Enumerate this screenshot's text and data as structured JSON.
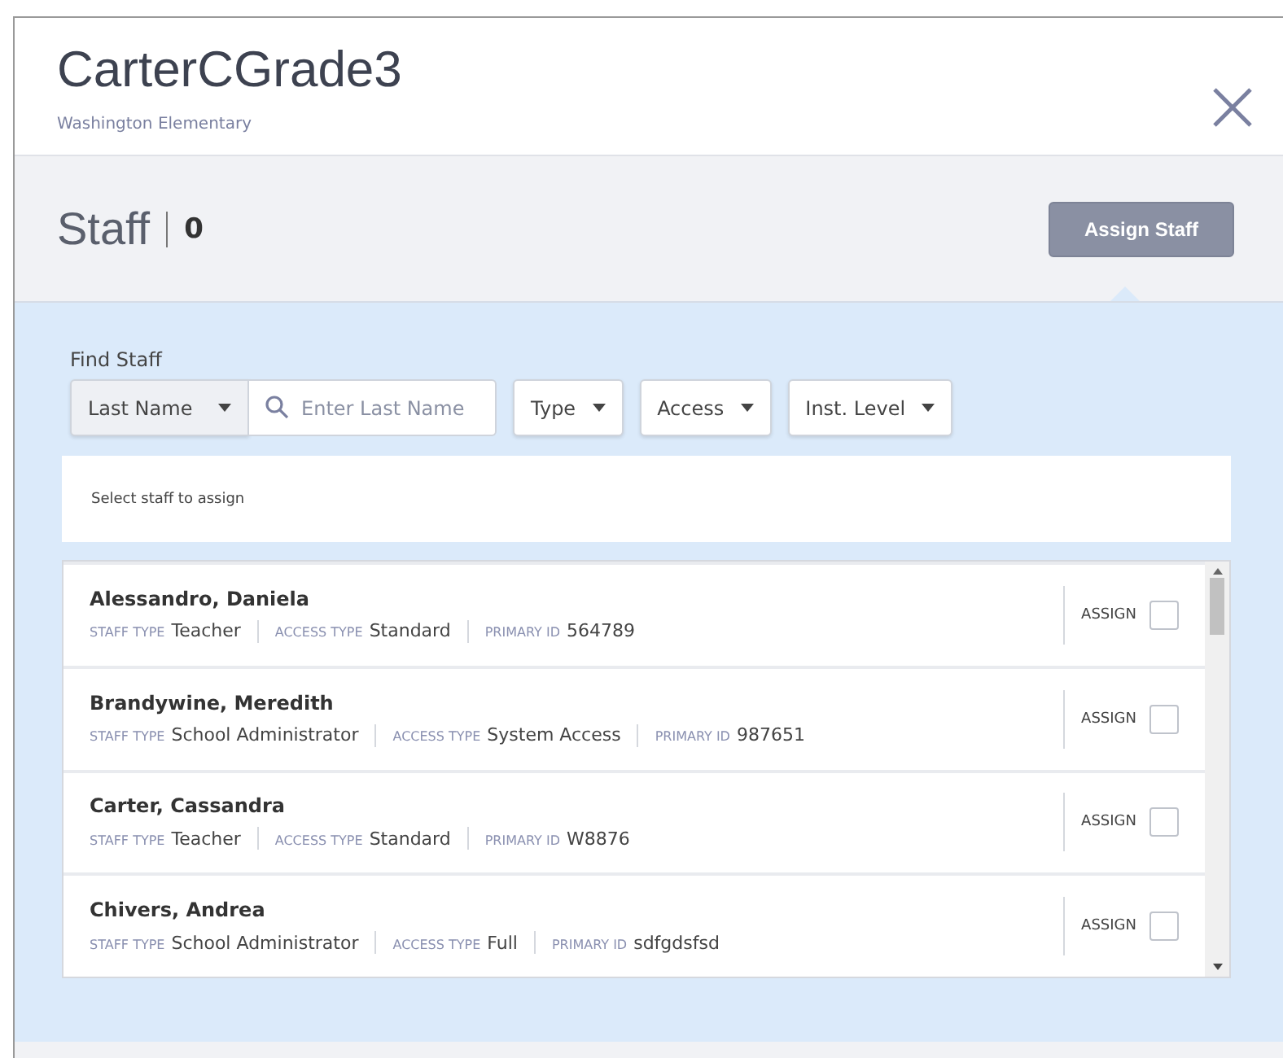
{
  "header": {
    "title": "CarterCGrade3",
    "subtitle": "Washington Elementary"
  },
  "staff_bar": {
    "label": "Staff",
    "count": "0",
    "assign_button": "Assign Staff"
  },
  "find": {
    "label": "Find Staff",
    "search_by": "Last Name",
    "search_placeholder": "Enter Last Name",
    "filters": [
      "Type",
      "Access",
      "Inst. Level"
    ]
  },
  "hint": "Select staff to assign",
  "staff": [
    {
      "name": "Alessandro, Daniela",
      "fields": [
        {
          "label": "STAFF TYPE",
          "value": "Teacher"
        },
        {
          "label": "ACCESS TYPE",
          "value": "Standard"
        },
        {
          "label": "PRIMARY ID",
          "value": "564789"
        }
      ],
      "assign_label": "ASSIGN",
      "checked": false
    },
    {
      "name": "Brandywine, Meredith",
      "fields": [
        {
          "label": "STAFF TYPE",
          "value": "School Administrator"
        },
        {
          "label": "ACCESS TYPE",
          "value": "System Access"
        },
        {
          "label": "PRIMARY ID",
          "value": "987651"
        }
      ],
      "assign_label": "ASSIGN",
      "checked": false
    },
    {
      "name": "Carter, Cassandra",
      "fields": [
        {
          "label": "STAFF TYPE",
          "value": "Teacher"
        },
        {
          "label": "ACCESS TYPE",
          "value": "Standard"
        },
        {
          "label": "PRIMARY ID",
          "value": "W8876"
        }
      ],
      "assign_label": "ASSIGN",
      "checked": false
    },
    {
      "name": "Chivers, Andrea",
      "fields": [
        {
          "label": "STAFF TYPE",
          "value": "School Administrator"
        },
        {
          "label": "ACCESS TYPE",
          "value": "Full"
        },
        {
          "label": "PRIMARY ID",
          "value": "sdfgdsfsd"
        }
      ],
      "assign_label": "ASSIGN",
      "checked": false
    }
  ]
}
